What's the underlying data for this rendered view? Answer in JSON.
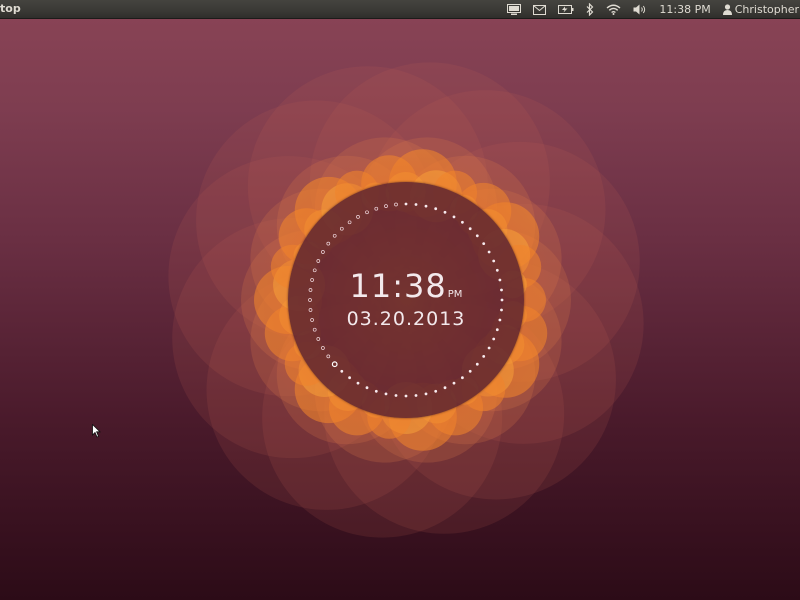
{
  "panel": {
    "app_title": "top",
    "clock": "11:38 PM",
    "user_name": "Christopher",
    "icons": [
      "display-icon",
      "mail-icon",
      "battery-icon",
      "bluetooth-icon",
      "wifi-icon",
      "volume-icon",
      "user-icon"
    ]
  },
  "clock_widget": {
    "time": "11:38",
    "ampm": "PM",
    "date": "03.20.2013"
  },
  "colors": {
    "panel_bg": "#3a3935",
    "panel_text": "#dfdbd2",
    "wallpaper_top": "#8a4456",
    "wallpaper_bottom": "#2c0b17",
    "flower_orange": "#f5892a",
    "clock_face": "#582030"
  }
}
